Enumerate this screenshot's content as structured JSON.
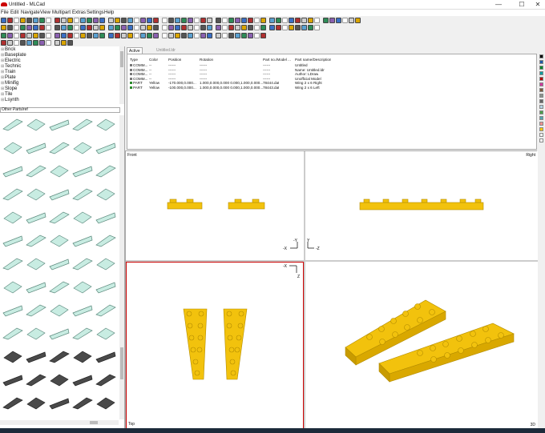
{
  "window": {
    "title": "Untitled - MLCad",
    "controls": [
      "—",
      "☐",
      "✕"
    ]
  },
  "menu": [
    {
      "id": "file",
      "label": "File"
    },
    {
      "id": "edit",
      "label": "Edit"
    },
    {
      "id": "navigate",
      "label": "Navigate"
    },
    {
      "id": "view",
      "label": "View"
    },
    {
      "id": "multipart",
      "label": "Multipart"
    },
    {
      "id": "extras",
      "label": "Extras"
    },
    {
      "id": "settings",
      "label": "Settings"
    },
    {
      "id": "help",
      "label": "Help"
    }
  ],
  "sidebar": {
    "categories": [
      "Brick",
      "Baseplate",
      "Electric",
      "Technic",
      "Train",
      "Plate",
      "Minifig",
      "Slope",
      "Tile",
      "Lsynth"
    ],
    "filter_value": "Other Parts/ref"
  },
  "tabs": [
    {
      "label": "Active Model",
      "active": true
    },
    {
      "label": "Untitled.ldr",
      "active": false
    }
  ],
  "parts_table": {
    "headers": [
      "Type",
      "Color",
      "Position",
      "Rotation",
      "Part no./Model ...",
      "Part name/Description"
    ],
    "rows": [
      {
        "type": "COMM...",
        "color": "--",
        "position": "------",
        "rotation": "------",
        "partno": "------",
        "desc": "Untitled",
        "icon": "comment"
      },
      {
        "type": "COMM...",
        "color": "--",
        "position": "------",
        "rotation": "------",
        "partno": "------",
        "desc": "Name: Untitled.ldr",
        "icon": "comment"
      },
      {
        "type": "COMM...",
        "color": "--",
        "position": "------",
        "rotation": "------",
        "partno": "------",
        "desc": "Author: LDraw",
        "icon": "comment"
      },
      {
        "type": "COMM...",
        "color": "--",
        "position": "------",
        "rotation": "------",
        "partno": "------",
        "desc": "Unofficial Model",
        "icon": "comment"
      },
      {
        "type": "PART",
        "color": "Yellow",
        "position": "-170.000,0.000...",
        "rotation": "1.000,0.000,0.000 0.000,1.000,0.000...",
        "partno": "78444.dat",
        "desc": "Wing 2 x 6 Right",
        "icon": "part"
      },
      {
        "type": "PART",
        "color": "Yellow",
        "position": "-100.000,0.000...",
        "rotation": "1.000,0.000,0.000 0.000,1.000,0.000...",
        "partno": "78443.dat",
        "desc": "Wing 2 x 6 Left",
        "icon": "part"
      }
    ]
  },
  "palette_colors": [
    "#000000",
    "#1e5aa8",
    "#00852b",
    "#069d9f",
    "#b40000",
    "#d3359d",
    "#7b5a3c",
    "#8a928d",
    "#646464",
    "#b4d2e3",
    "#4b9f4a",
    "#55a5af",
    "#f08f8f",
    "#fac80a",
    "#f2f3f2",
    "#ffffff"
  ],
  "viewports": {
    "front": "Front",
    "right": "Right",
    "top": "Top",
    "three_d": "3D",
    "axes": {
      "x": "-X",
      "y": "-Y",
      "z": "Z",
      "y2": "Y",
      "z2": "-Z"
    }
  },
  "colors": {
    "brick_yellow": "#f2c20d",
    "brick_edge": "#b38c00",
    "selected_border": "#cc0000"
  }
}
